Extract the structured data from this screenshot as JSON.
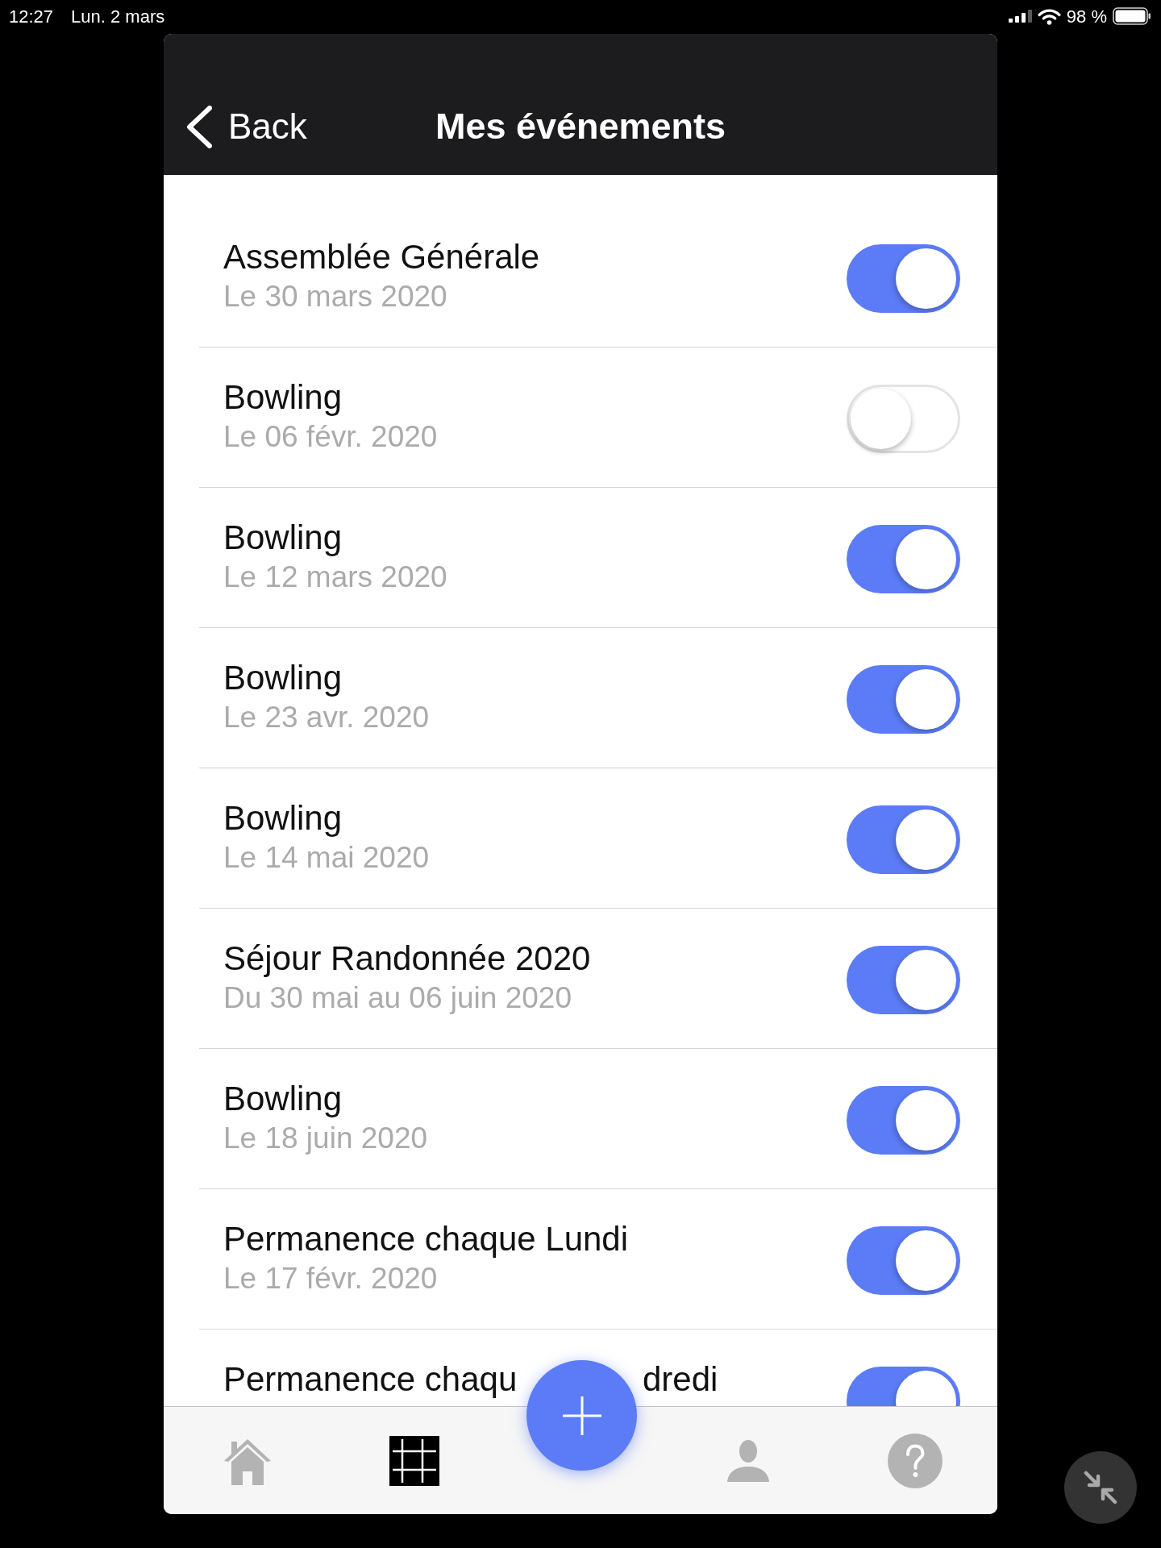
{
  "status_bar": {
    "time": "12:27",
    "date": "Lun. 2 mars",
    "battery": "98 %"
  },
  "header": {
    "back": "Back",
    "title": "Mes événements"
  },
  "events": [
    {
      "title": "Assemblée Générale",
      "date": "Le 30 mars 2020",
      "on": true
    },
    {
      "title": "Bowling",
      "date": "Le 06 févr. 2020",
      "on": false
    },
    {
      "title": "Bowling",
      "date": "Le 12 mars 2020",
      "on": true
    },
    {
      "title": "Bowling",
      "date": "Le 23 avr. 2020",
      "on": true
    },
    {
      "title": "Bowling",
      "date": "Le 14 mai 2020",
      "on": true
    },
    {
      "title": "Séjour Randonnée 2020",
      "date": "Du 30 mai au 06 juin 2020",
      "on": true
    },
    {
      "title": "Bowling",
      "date": "Le 18 juin 2020",
      "on": true
    },
    {
      "title": "Permanence chaque Lundi",
      "date": "Le 17 févr. 2020",
      "on": true
    },
    {
      "title_parts": [
        "Permanence chaqu",
        "dredi"
      ],
      "on": true
    }
  ],
  "tab_bar": [
    {
      "kind": "home",
      "selected": false
    },
    {
      "kind": "grid",
      "selected": true
    },
    {
      "kind": "person",
      "selected": false
    },
    {
      "kind": "help",
      "selected": false
    }
  ]
}
